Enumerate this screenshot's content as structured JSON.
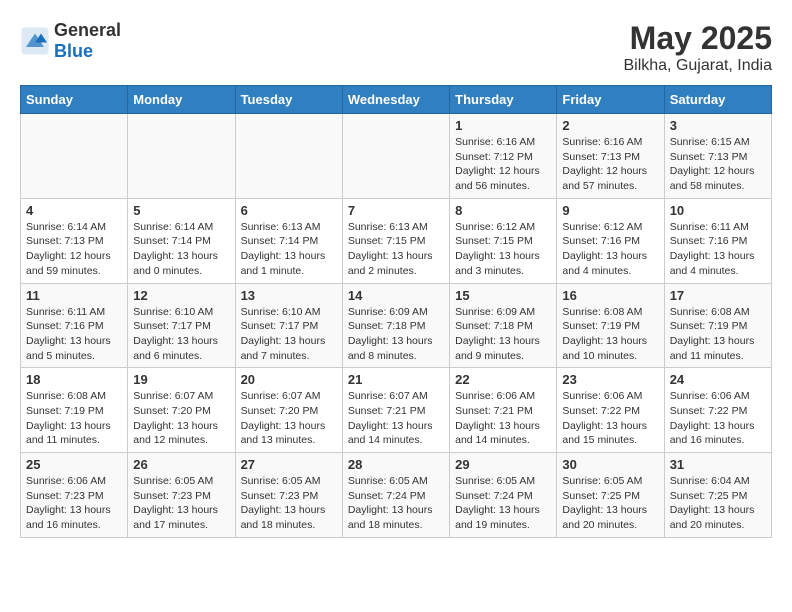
{
  "header": {
    "logo_general": "General",
    "logo_blue": "Blue",
    "title": "May 2025",
    "subtitle": "Bilkha, Gujarat, India"
  },
  "weekdays": [
    "Sunday",
    "Monday",
    "Tuesday",
    "Wednesday",
    "Thursday",
    "Friday",
    "Saturday"
  ],
  "weeks": [
    [
      {
        "day": "",
        "info": ""
      },
      {
        "day": "",
        "info": ""
      },
      {
        "day": "",
        "info": ""
      },
      {
        "day": "",
        "info": ""
      },
      {
        "day": "1",
        "info": "Sunrise: 6:16 AM\nSunset: 7:12 PM\nDaylight: 12 hours\nand 56 minutes."
      },
      {
        "day": "2",
        "info": "Sunrise: 6:16 AM\nSunset: 7:13 PM\nDaylight: 12 hours\nand 57 minutes."
      },
      {
        "day": "3",
        "info": "Sunrise: 6:15 AM\nSunset: 7:13 PM\nDaylight: 12 hours\nand 58 minutes."
      }
    ],
    [
      {
        "day": "4",
        "info": "Sunrise: 6:14 AM\nSunset: 7:13 PM\nDaylight: 12 hours\nand 59 minutes."
      },
      {
        "day": "5",
        "info": "Sunrise: 6:14 AM\nSunset: 7:14 PM\nDaylight: 13 hours\nand 0 minutes."
      },
      {
        "day": "6",
        "info": "Sunrise: 6:13 AM\nSunset: 7:14 PM\nDaylight: 13 hours\nand 1 minute."
      },
      {
        "day": "7",
        "info": "Sunrise: 6:13 AM\nSunset: 7:15 PM\nDaylight: 13 hours\nand 2 minutes."
      },
      {
        "day": "8",
        "info": "Sunrise: 6:12 AM\nSunset: 7:15 PM\nDaylight: 13 hours\nand 3 minutes."
      },
      {
        "day": "9",
        "info": "Sunrise: 6:12 AM\nSunset: 7:16 PM\nDaylight: 13 hours\nand 4 minutes."
      },
      {
        "day": "10",
        "info": "Sunrise: 6:11 AM\nSunset: 7:16 PM\nDaylight: 13 hours\nand 4 minutes."
      }
    ],
    [
      {
        "day": "11",
        "info": "Sunrise: 6:11 AM\nSunset: 7:16 PM\nDaylight: 13 hours\nand 5 minutes."
      },
      {
        "day": "12",
        "info": "Sunrise: 6:10 AM\nSunset: 7:17 PM\nDaylight: 13 hours\nand 6 minutes."
      },
      {
        "day": "13",
        "info": "Sunrise: 6:10 AM\nSunset: 7:17 PM\nDaylight: 13 hours\nand 7 minutes."
      },
      {
        "day": "14",
        "info": "Sunrise: 6:09 AM\nSunset: 7:18 PM\nDaylight: 13 hours\nand 8 minutes."
      },
      {
        "day": "15",
        "info": "Sunrise: 6:09 AM\nSunset: 7:18 PM\nDaylight: 13 hours\nand 9 minutes."
      },
      {
        "day": "16",
        "info": "Sunrise: 6:08 AM\nSunset: 7:19 PM\nDaylight: 13 hours\nand 10 minutes."
      },
      {
        "day": "17",
        "info": "Sunrise: 6:08 AM\nSunset: 7:19 PM\nDaylight: 13 hours\nand 11 minutes."
      }
    ],
    [
      {
        "day": "18",
        "info": "Sunrise: 6:08 AM\nSunset: 7:19 PM\nDaylight: 13 hours\nand 11 minutes."
      },
      {
        "day": "19",
        "info": "Sunrise: 6:07 AM\nSunset: 7:20 PM\nDaylight: 13 hours\nand 12 minutes."
      },
      {
        "day": "20",
        "info": "Sunrise: 6:07 AM\nSunset: 7:20 PM\nDaylight: 13 hours\nand 13 minutes."
      },
      {
        "day": "21",
        "info": "Sunrise: 6:07 AM\nSunset: 7:21 PM\nDaylight: 13 hours\nand 14 minutes."
      },
      {
        "day": "22",
        "info": "Sunrise: 6:06 AM\nSunset: 7:21 PM\nDaylight: 13 hours\nand 14 minutes."
      },
      {
        "day": "23",
        "info": "Sunrise: 6:06 AM\nSunset: 7:22 PM\nDaylight: 13 hours\nand 15 minutes."
      },
      {
        "day": "24",
        "info": "Sunrise: 6:06 AM\nSunset: 7:22 PM\nDaylight: 13 hours\nand 16 minutes."
      }
    ],
    [
      {
        "day": "25",
        "info": "Sunrise: 6:06 AM\nSunset: 7:23 PM\nDaylight: 13 hours\nand 16 minutes."
      },
      {
        "day": "26",
        "info": "Sunrise: 6:05 AM\nSunset: 7:23 PM\nDaylight: 13 hours\nand 17 minutes."
      },
      {
        "day": "27",
        "info": "Sunrise: 6:05 AM\nSunset: 7:23 PM\nDaylight: 13 hours\nand 18 minutes."
      },
      {
        "day": "28",
        "info": "Sunrise: 6:05 AM\nSunset: 7:24 PM\nDaylight: 13 hours\nand 18 minutes."
      },
      {
        "day": "29",
        "info": "Sunrise: 6:05 AM\nSunset: 7:24 PM\nDaylight: 13 hours\nand 19 minutes."
      },
      {
        "day": "30",
        "info": "Sunrise: 6:05 AM\nSunset: 7:25 PM\nDaylight: 13 hours\nand 20 minutes."
      },
      {
        "day": "31",
        "info": "Sunrise: 6:04 AM\nSunset: 7:25 PM\nDaylight: 13 hours\nand 20 minutes."
      }
    ]
  ]
}
